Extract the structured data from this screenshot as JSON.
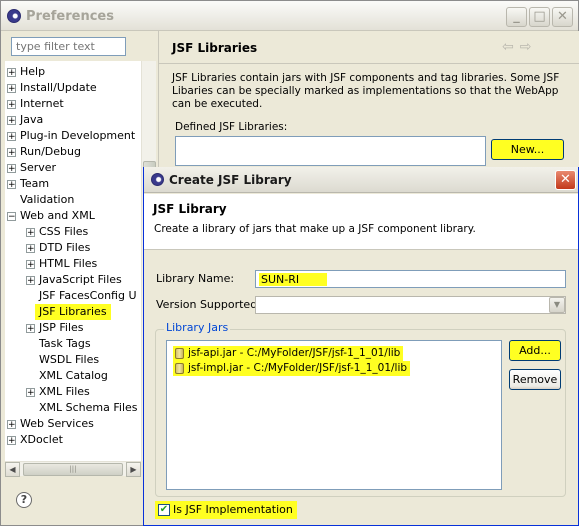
{
  "preferences": {
    "title": "Preferences",
    "filter_placeholder": "type filter text",
    "tree": [
      {
        "label": "Help",
        "level": 0,
        "expander": "+"
      },
      {
        "label": "Install/Update",
        "level": 0,
        "expander": "+"
      },
      {
        "label": "Internet",
        "level": 0,
        "expander": "+"
      },
      {
        "label": "Java",
        "level": 0,
        "expander": "+"
      },
      {
        "label": "Plug-in Development",
        "level": 0,
        "expander": "+"
      },
      {
        "label": "Run/Debug",
        "level": 0,
        "expander": "+"
      },
      {
        "label": "Server",
        "level": 0,
        "expander": "+"
      },
      {
        "label": "Team",
        "level": 0,
        "expander": "+"
      },
      {
        "label": "Validation",
        "level": 0,
        "expander": ""
      },
      {
        "label": "Web and XML",
        "level": 0,
        "expander": "-"
      },
      {
        "label": "CSS Files",
        "level": 1,
        "expander": "+"
      },
      {
        "label": "DTD Files",
        "level": 1,
        "expander": "+"
      },
      {
        "label": "HTML Files",
        "level": 1,
        "expander": "+"
      },
      {
        "label": "JavaScript Files",
        "level": 1,
        "expander": "+"
      },
      {
        "label": "JSF FacesConfig U",
        "level": 1,
        "expander": ""
      },
      {
        "label": "JSF Libraries",
        "level": 1,
        "expander": "",
        "selected": true
      },
      {
        "label": "JSP Files",
        "level": 1,
        "expander": "+"
      },
      {
        "label": "Task Tags",
        "level": 1,
        "expander": ""
      },
      {
        "label": "WSDL Files",
        "level": 1,
        "expander": ""
      },
      {
        "label": "XML Catalog",
        "level": 1,
        "expander": ""
      },
      {
        "label": "XML Files",
        "level": 1,
        "expander": "+"
      },
      {
        "label": "XML Schema Files",
        "level": 1,
        "expander": ""
      },
      {
        "label": "Web Services",
        "level": 0,
        "expander": "+"
      },
      {
        "label": "XDoclet",
        "level": 0,
        "expander": "+"
      }
    ],
    "page": {
      "title": "JSF Libraries",
      "description": "JSF Libraries contain jars with JSF components and tag libraries.   Some JSF Libaries can be specially marked as implementations so that the WebApp can be executed.",
      "defined_label": "Defined JSF Libraries:",
      "new_button": "New..."
    }
  },
  "dialog": {
    "title": "Create JSF Library",
    "header_title": "JSF Library",
    "header_desc": "Create a library of jars that make up a JSF component library.",
    "library_name_label": "Library Name:",
    "library_name_value": "SUN-RI",
    "version_label": "Version Supported:",
    "version_value": "",
    "jars_group_label": "Library Jars",
    "jars": [
      "jsf-api.jar - C:/MyFolder/JSF/jsf-1_1_01/lib",
      "jsf-impl.jar - C:/MyFolder/JSF/jsf-1_1_01/lib"
    ],
    "add_button": "Add...",
    "remove_button": "Remove",
    "is_impl_label": "Is JSF Implementation",
    "is_impl_checked": true
  }
}
